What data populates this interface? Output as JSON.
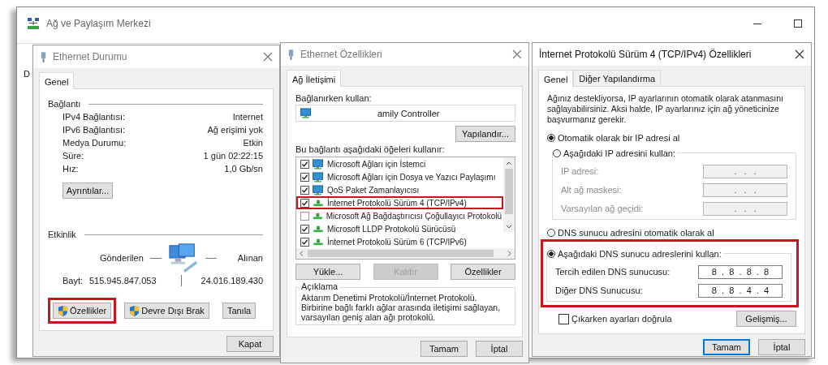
{
  "background_window": {
    "title": "Ağ ve Paylaşım Merkezi",
    "peek_text": "D"
  },
  "status_dialog": {
    "title": "Ethernet Durumu",
    "tabs": [
      {
        "label": "Genel",
        "selected": true
      }
    ],
    "connection": {
      "heading": "Bağlantı",
      "rows": [
        {
          "label": "IPv4 Bağlantısı:",
          "value": "Internet"
        },
        {
          "label": "IPv6 Bağlantısı:",
          "value": "Ağ erişimi yok"
        },
        {
          "label": "Medya Durumu:",
          "value": "Etkin"
        },
        {
          "label": "Süre:",
          "value": "1 gün 02:22:15"
        },
        {
          "label": "Hız:",
          "value": "1,0 Gb/sn"
        }
      ]
    },
    "details_button": "Ayrıntılar...",
    "activity": {
      "heading": "Etkinlik",
      "sent_label": "Gönderilen",
      "received_label": "Alınan",
      "bytes_label": "Bayt:",
      "sent": "515.945.847.053",
      "received": "24.016.189.430"
    },
    "buttons": [
      {
        "label": "Özellikler",
        "shield": true,
        "highlighted": true
      },
      {
        "label": "Devre Dışı Brak",
        "shield": true,
        "highlighted": false
      },
      {
        "label": "Tanıla",
        "shield": false,
        "highlighted": false
      }
    ],
    "close_button": "Kapat"
  },
  "properties_dialog": {
    "title": "Ethernet Özellikleri",
    "tabs": [
      {
        "label": "Ağ İletişimi",
        "selected": true
      }
    ],
    "connect_using_label": "Bağlanırken kullan:",
    "adapter": "amily Controller",
    "configure_button": "Yapılandır...",
    "items_label": "Bu bağlantı aşağıdaki öğeleri kullanır:",
    "items": [
      {
        "label": "Microsoft Ağları için İstemci",
        "checked": true,
        "kind": "client",
        "highlighted": false
      },
      {
        "label": "Microsoft Ağları için Dosya ve Yazıcı Paylaşımı",
        "checked": true,
        "kind": "client",
        "highlighted": false
      },
      {
        "label": "QoS Paket Zamanlayıcısı",
        "checked": true,
        "kind": "client",
        "highlighted": false
      },
      {
        "label": "İnternet Protokolü Sürüm 4 (TCP/IPv4)",
        "checked": true,
        "kind": "protocol",
        "highlighted": true
      },
      {
        "label": "Microsoft Ağ Bağdaştırıcısı Çoğullayıcı Protokolü",
        "checked": false,
        "kind": "protocol",
        "highlighted": false
      },
      {
        "label": "Microsoft LLDP Protokolü Sürücüsü",
        "checked": true,
        "kind": "protocol",
        "highlighted": false
      },
      {
        "label": "İnternet Protokolü Sürüm 6 (TCP/IPv6)",
        "checked": true,
        "kind": "protocol",
        "highlighted": false
      }
    ],
    "buttons": [
      {
        "label": "Yükle...",
        "disabled": false
      },
      {
        "label": "Kaldır",
        "disabled": true
      },
      {
        "label": "Özellikler",
        "disabled": false
      }
    ],
    "description": {
      "heading": "Açıklama",
      "text": "Aktarım Denetimi Protokolü/İnternet Protokolü. Birbirine bağlı farklı ağlar arasında iletişimi sağlayan, varsayılan geniş alan ağı protokolü."
    },
    "footer": [
      {
        "label": "Tamam",
        "default": false
      },
      {
        "label": "İptal",
        "default": false
      }
    ]
  },
  "ipv4_dialog": {
    "title": "İnternet Protokolü Sürüm 4 (TCP/IPv4) Özellikleri",
    "tabs": [
      {
        "label": "Genel",
        "selected": true
      },
      {
        "label": "Diğer Yapılandırma",
        "selected": false
      }
    ],
    "intro": "Ağınız destekliyorsa, IP ayarlarının otomatik olarak atanmasını sağlayabilirsiniz. Aksi halde, IP ayarlarınız için ağ yöneticinize başvurmanız gerekir.",
    "ip_options": [
      {
        "label": "Otomatik olarak bir IP adresi al",
        "selected": true
      },
      {
        "label": "Aşağıdaki IP adresini kullan:",
        "selected": false
      }
    ],
    "ip_fields": [
      {
        "label": "IP adresi:",
        "value": ".   .   .",
        "disabled": true
      },
      {
        "label": "Alt ağ maskesi:",
        "value": ".   .   .",
        "disabled": true
      },
      {
        "label": "Varsayılan ağ geçidi:",
        "value": ".   .   .",
        "disabled": true
      }
    ],
    "dns_options": [
      {
        "label": "DNS sunucu adresini otomatik olarak al",
        "selected": false
      },
      {
        "label": "Aşağıdaki DNS sunucu adreslerini kullan:",
        "selected": true
      }
    ],
    "dns_highlighted": true,
    "dns_fields": [
      {
        "label": "Tercih edilen DNS sunucusu:",
        "value": "8  .  8  .  8  .  8",
        "disabled": false
      },
      {
        "label": "Diğer DNS Sunucusu:",
        "value": "8  .  8  .  4  .  4",
        "disabled": false
      }
    ],
    "validate": {
      "label": "Çıkarken ayarları doğrula",
      "checked": false
    },
    "advanced_button": "Gelişmiş...",
    "footer": [
      {
        "label": "Tamam",
        "default": true
      },
      {
        "label": "İptal",
        "default": false
      }
    ]
  }
}
